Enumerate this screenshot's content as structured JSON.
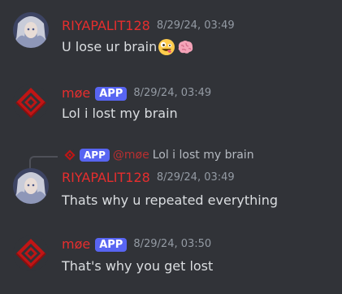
{
  "messages": [
    {
      "username": "RIYAPALIT128",
      "timestamp": "8/29/24, 03:49",
      "text": "U lose ur brain",
      "emojis": [
        "zany-face",
        "brain"
      ]
    },
    {
      "username": "møe",
      "badge": "APP",
      "timestamp": "8/29/24, 03:49",
      "text": "Lol i lost my brain"
    },
    {
      "reply": {
        "badge": "APP",
        "mention": "@møe",
        "text": "Lol i lost my brain"
      },
      "username": "RIYAPALIT128",
      "timestamp": "8/29/24, 03:49",
      "text": "Thats why u repeated everything"
    },
    {
      "username": "møe",
      "badge": "APP",
      "timestamp": "8/29/24, 03:50",
      "text": "That's why you get lost"
    }
  ],
  "colors": {
    "background": "#313338",
    "username": "#e62e2e",
    "badge": "#5865f2",
    "text": "#dbdee1",
    "timestamp": "#949ba4"
  }
}
